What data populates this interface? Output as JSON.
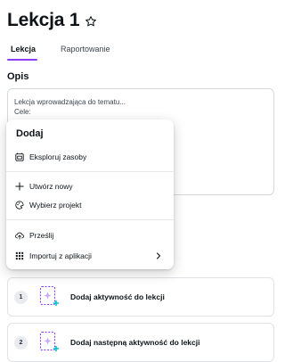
{
  "page": {
    "title": "Lekcja 1"
  },
  "tabs": [
    {
      "label": "Lekcja",
      "active": true
    },
    {
      "label": "Raportowanie",
      "active": false
    }
  ],
  "description": {
    "heading": "Opis",
    "line1": "Lekcja wprowadzająca do tematu...",
    "line2": "Cele:"
  },
  "menu": {
    "title": "Dodaj",
    "items": [
      {
        "label": "Eksploruj zasoby",
        "icon": "library-icon"
      },
      {
        "label": "Utwórz nowy",
        "icon": "plus-icon"
      },
      {
        "label": "Wybierz projekt",
        "icon": "design-icon"
      },
      {
        "label": "Prześlij",
        "icon": "upload-cloud-icon"
      },
      {
        "label": "Importuj z aplikacji",
        "icon": "apps-grid-icon",
        "submenu": true
      }
    ]
  },
  "activities": [
    {
      "number": "1",
      "label": "Dodaj aktywność do lekcji"
    },
    {
      "number": "2",
      "label": "Dodaj następną aktywność do lekcji"
    }
  ],
  "colors": {
    "accent": "#8b3dff",
    "accent_light": "#c9a8ff",
    "add_badge": "#00c4cc"
  }
}
